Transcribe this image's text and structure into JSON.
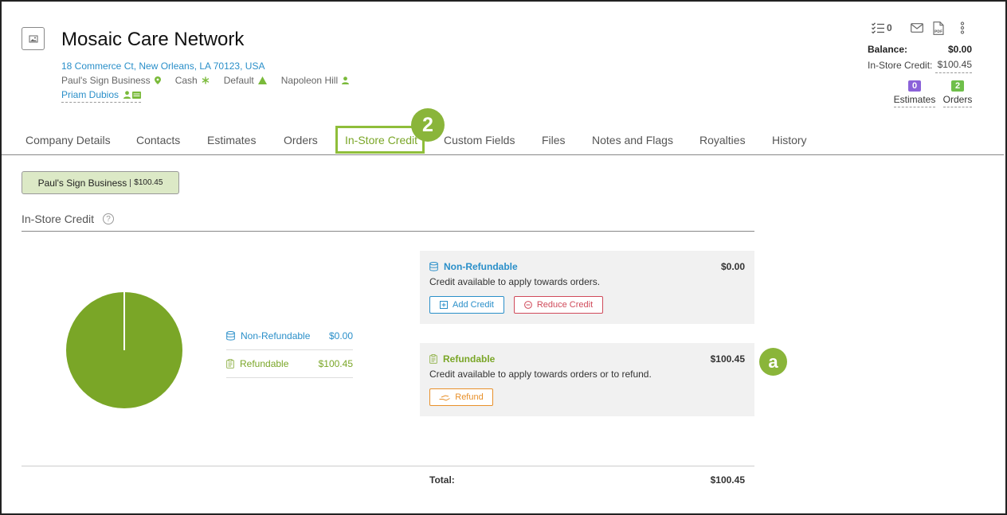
{
  "company": {
    "name": "Mosaic Care Network",
    "address": "18 Commerce Ct, New Orleans, LA 70123, USA",
    "meta": [
      {
        "label": "Paul's Sign Business",
        "icon": "location-pin-icon"
      },
      {
        "label": "Cash",
        "icon": "asterisk-icon"
      },
      {
        "label": "Default",
        "icon": "triangle-icon"
      },
      {
        "label": "Napoleon Hill",
        "icon": "person-icon"
      }
    ],
    "contact": "Priam Dubios"
  },
  "header_tools": {
    "task_count": "0",
    "icons": [
      "checklist-icon",
      "mail-icon",
      "pdf-icon",
      "more-vertical-icon"
    ]
  },
  "balance": {
    "label": "Balance:",
    "value": "$0.00",
    "isc_label": "In-Store Credit:",
    "isc_value": "$100.45"
  },
  "counts": {
    "estimates": {
      "count": "0",
      "label": "Estimates",
      "color": "#8b62d9"
    },
    "orders": {
      "count": "2",
      "label": "Orders",
      "color": "#6fbf4a"
    }
  },
  "tabs": [
    {
      "label": "Company Details"
    },
    {
      "label": "Contacts"
    },
    {
      "label": "Estimates"
    },
    {
      "label": "Orders"
    },
    {
      "label": "In-Store Credit"
    },
    {
      "label": "Custom Fields"
    },
    {
      "label": "Files"
    },
    {
      "label": "Notes and Flags"
    },
    {
      "label": "Royalties"
    },
    {
      "label": "History"
    }
  ],
  "active_tab": "In-Store Credit",
  "step_badges": {
    "tab": "2",
    "card": "a"
  },
  "store_pill": {
    "name": "Paul's Sign Business",
    "amount": "$100.45"
  },
  "section_title": "In-Store Credit",
  "legend": [
    {
      "label": "Non-Refundable",
      "value": "$0.00",
      "color": "#2a8fc9",
      "icon": "database-icon"
    },
    {
      "label": "Refundable",
      "value": "$100.45",
      "color": "#7aa627",
      "icon": "clipboard-icon"
    }
  ],
  "chart_data": {
    "type": "pie",
    "categories": [
      "Non-Refundable",
      "Refundable"
    ],
    "values": [
      0.0,
      100.45
    ],
    "colors": [
      "#2a8fc9",
      "#7aa627"
    ]
  },
  "cards": {
    "non_refundable": {
      "title": "Non-Refundable",
      "amount": "$0.00",
      "description": "Credit available to apply towards orders.",
      "add_label": "Add Credit",
      "reduce_label": "Reduce Credit"
    },
    "refundable": {
      "title": "Refundable",
      "amount": "$100.45",
      "description": "Credit available to apply towards orders or to refund.",
      "refund_label": "Refund"
    }
  },
  "total": {
    "label": "Total:",
    "value": "$100.45"
  }
}
